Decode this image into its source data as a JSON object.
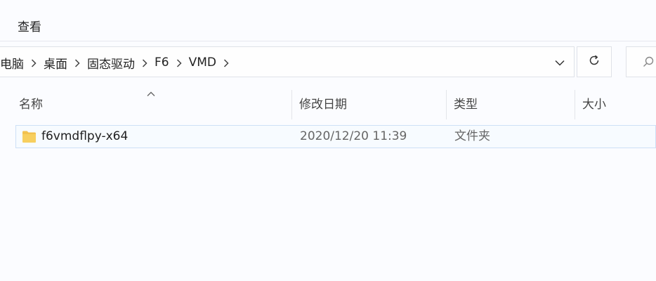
{
  "menu": {
    "view_label": "查看"
  },
  "address": {
    "crumbs": [
      "电脑",
      "桌面",
      "固态驱动",
      "F6",
      "VMD"
    ]
  },
  "columns": {
    "name": "名称",
    "modified": "修改日期",
    "type": "类型",
    "size": "大小"
  },
  "files": [
    {
      "name": "f6vmdflpy-x64",
      "modified": "2020/12/20 11:39",
      "type": "文件夹",
      "size": ""
    }
  ],
  "icons": {
    "folder": "folder-icon",
    "refresh": "refresh-icon",
    "search": "search-icon",
    "dropdown": "chevron-down-icon",
    "sort": "sort-up-icon"
  },
  "colors": {
    "folder": "#f2c14e",
    "selection_border": "#cde0f6",
    "selection_bg": "#f7fbff"
  }
}
